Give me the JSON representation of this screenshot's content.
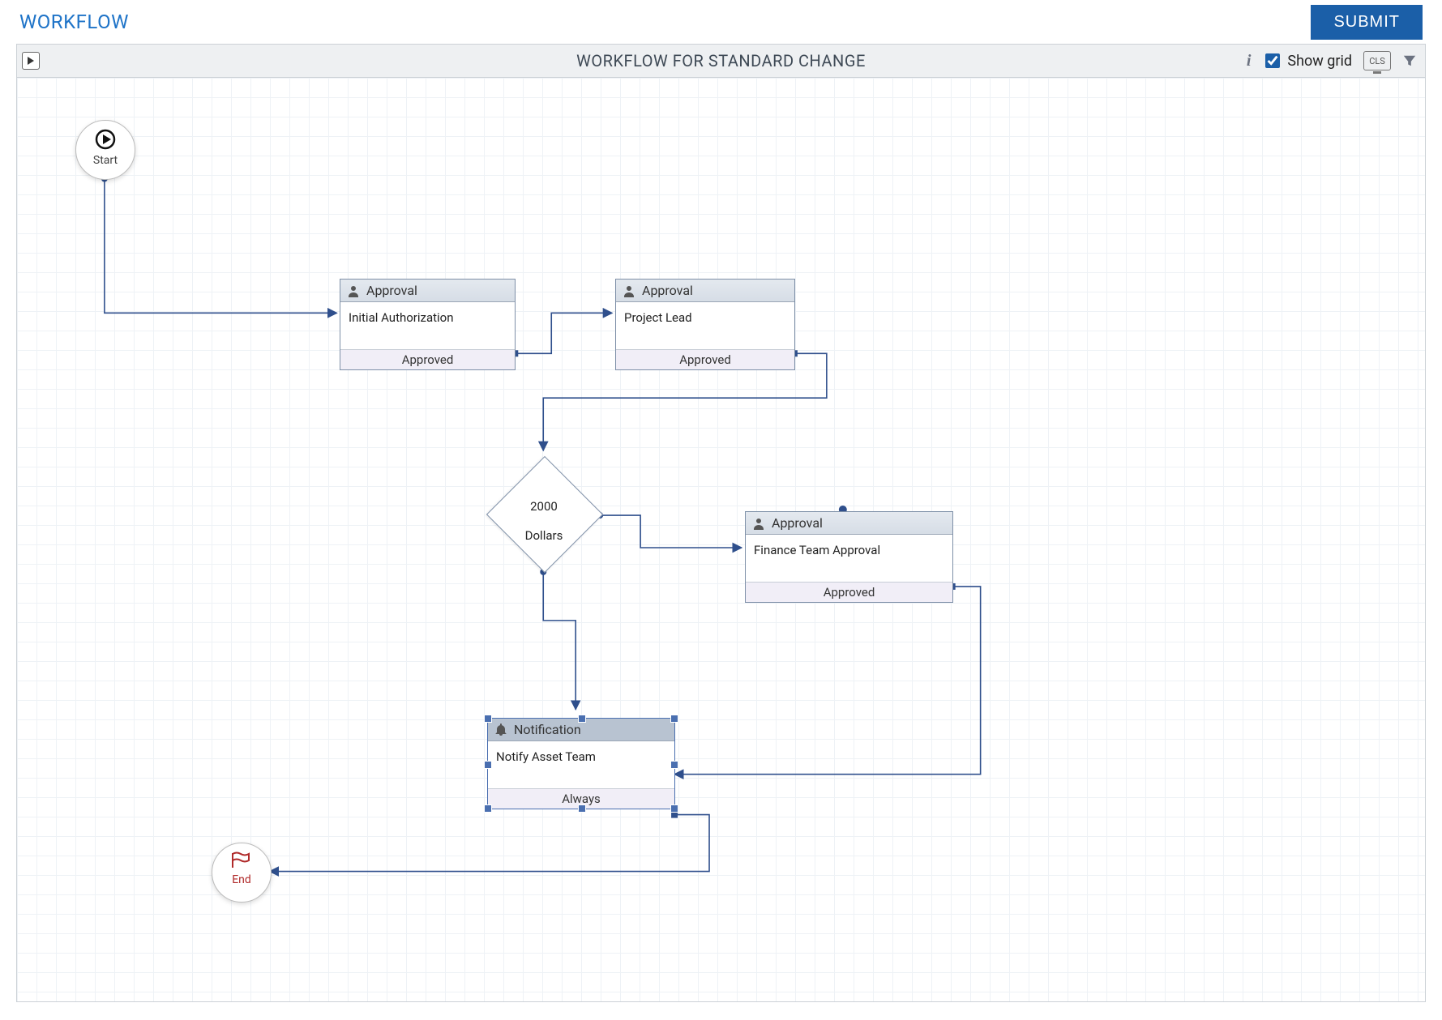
{
  "header": {
    "title": "WORKFLOW",
    "submit_label": "SUBMIT"
  },
  "toolbar": {
    "title": "WORKFLOW FOR STANDARD CHANGE",
    "show_grid_label": "Show grid",
    "show_grid_checked": true,
    "cls_label": "CLS"
  },
  "canvas": {
    "grid_visible": true
  },
  "nodes": {
    "start": {
      "label": "Start"
    },
    "end": {
      "label": "End"
    },
    "approval1": {
      "type_label": "Approval",
      "body": "Initial Authorization",
      "foot": "Approved"
    },
    "approval2": {
      "type_label": "Approval",
      "body": "Project Lead",
      "foot": "Approved"
    },
    "decision": {
      "line1": "2000",
      "line2": "Dollars"
    },
    "approval3": {
      "type_label": "Approval",
      "body": "Finance Team Approval",
      "foot": "Approved"
    },
    "notification": {
      "type_label": "Notification",
      "body": "Notify Asset Team",
      "foot": "Always",
      "selected": true
    }
  },
  "icons": {
    "user": "user-icon",
    "bell": "bell-icon",
    "play": "play-icon",
    "flag": "flag-icon"
  }
}
